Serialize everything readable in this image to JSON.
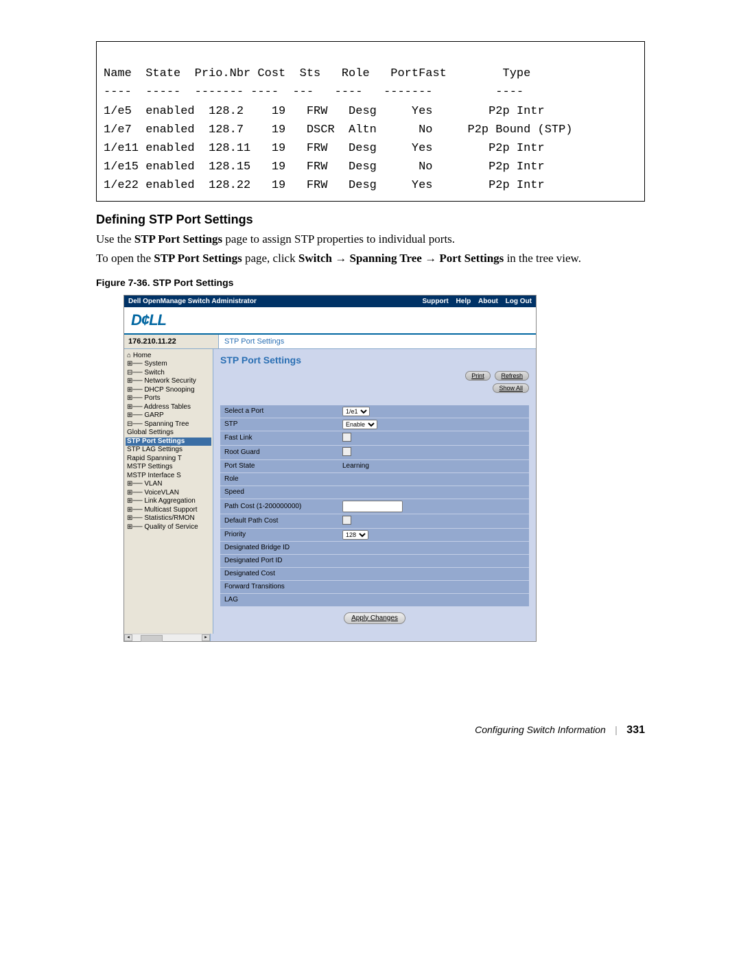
{
  "cli": {
    "header": "Name  State  Prio.Nbr Cost  Sts   Role   PortFast        Type",
    "divider": "----  -----  ------- ----  ---   ----   -------         ----",
    "rows": [
      "1/e5  enabled  128.2    19   FRW   Desg     Yes        P2p Intr",
      "1/e7  enabled  128.7    19   DSCR  Altn      No     P2p Bound (STP)",
      "1/e11 enabled  128.11   19   FRW   Desg     Yes        P2p Intr",
      "1/e15 enabled  128.15   19   FRW   Desg      No        P2p Intr",
      "1/e22 enabled  128.22   19   FRW   Desg     Yes        P2p Intr"
    ]
  },
  "section": {
    "heading": "Defining STP Port Settings",
    "p1_a": "Use the ",
    "p1_b": "STP Port Settings",
    "p1_c": " page to assign STP properties to individual ports.",
    "p2_a": "To open the ",
    "p2_b": "STP Port Settings",
    "p2_c": " page, click ",
    "p2_d": "Switch",
    "p2_e": "Spanning Tree",
    "p2_f": "Port Settings",
    "p2_g": " in the tree view.",
    "arrow": "→"
  },
  "figure": {
    "caption": "Figure 7-36.    STP Port Settings"
  },
  "shot": {
    "titlebar": "Dell OpenManage Switch Administrator",
    "toplinks": {
      "support": "Support",
      "help": "Help",
      "about": "About",
      "logout": "Log Out"
    },
    "logo": "D¢LL",
    "ip": "176.210.11.22",
    "crumb": "STP Port Settings",
    "nav": [
      "⌂ Home",
      "⊞── System",
      "⊟── Switch",
      "  ⊞── Network Security",
      "  ⊞── DHCP Snooping",
      "  ⊞── Ports",
      "  ⊞── Address Tables",
      "  ⊞── GARP",
      "  ⊟── Spanning Tree",
      "          Global Settings",
      "          STP Port Settings",
      "          STP LAG Settings",
      "          Rapid Spanning T",
      "          MSTP Settings",
      "          MSTP Interface S",
      "  ⊞── VLAN",
      "  ⊞── VoiceVLAN",
      "  ⊞── Link Aggregation",
      "  ⊞── Multicast Support",
      "⊞── Statistics/RMON",
      "⊞── Quality of Service"
    ],
    "nav_selected_index": 10,
    "main_title": "STP Port Settings",
    "buttons": {
      "print": "Print",
      "refresh": "Refresh",
      "showall": "Show All",
      "apply": "Apply Changes"
    },
    "fields": {
      "select_port": {
        "label": "Select a Port",
        "value": "1/e1"
      },
      "stp": {
        "label": "STP",
        "value": "Enable"
      },
      "fast_link": {
        "label": "Fast Link"
      },
      "root_guard": {
        "label": "Root Guard"
      },
      "port_state": {
        "label": "Port State",
        "value": "Learning"
      },
      "role": {
        "label": "Role"
      },
      "speed": {
        "label": "Speed"
      },
      "path_cost": {
        "label": "Path Cost (1-200000000)"
      },
      "default_pc": {
        "label": "Default Path Cost"
      },
      "priority": {
        "label": "Priority",
        "value": "128"
      },
      "dbid": {
        "label": "Designated Bridge ID"
      },
      "dpid": {
        "label": "Designated Port ID"
      },
      "dcost": {
        "label": "Designated Cost"
      },
      "ftrans": {
        "label": "Forward Transitions"
      },
      "lag": {
        "label": "LAG"
      }
    }
  },
  "footer": {
    "chapter": "Configuring Switch Information",
    "page": "331"
  }
}
